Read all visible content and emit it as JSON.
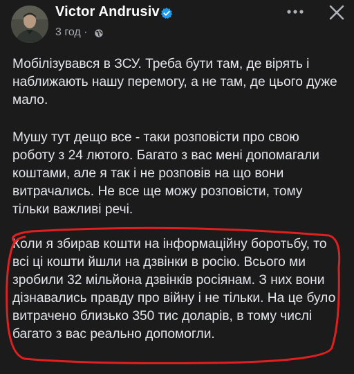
{
  "post": {
    "author": "Victor Andrusiv",
    "time": "3 год ·",
    "paragraphs": [
      "Мобілізувався в ЗСУ. Треба бути там, де вірять і наближають нашу перемогу, а не там, де цього дуже мало.",
      "Мушу тут дещо все - таки розповісти про свою роботу з 24 лютого. Багато з вас мені допомагали коштами, але я так і не розповів на що вони витрачались. Не все ще можу розповісти, тому тільки важливі речі.",
      "Коли я збирав кошти на інформаційну боротьбу, то всі ці кошти йшли на дзвінки в росію. Всього ми зробили 32 мільйона дзвінків росіянам. З них вони дізнавались правду про війну і не тільки. На це було витрачено близько 350 тис доларів, в тому числі багато з вас реально допомогли."
    ]
  },
  "icons": {
    "verified": "verified-badge-icon",
    "audience": "globe-icon",
    "more": "more-options-icon",
    "close": "close-icon"
  },
  "colors": {
    "background": "#1b1b1c",
    "text": "#e4e6eb",
    "secondary_text": "#a8abb0",
    "verified_badge": "#1d9bf0",
    "annotation_circle": "#e02020"
  }
}
